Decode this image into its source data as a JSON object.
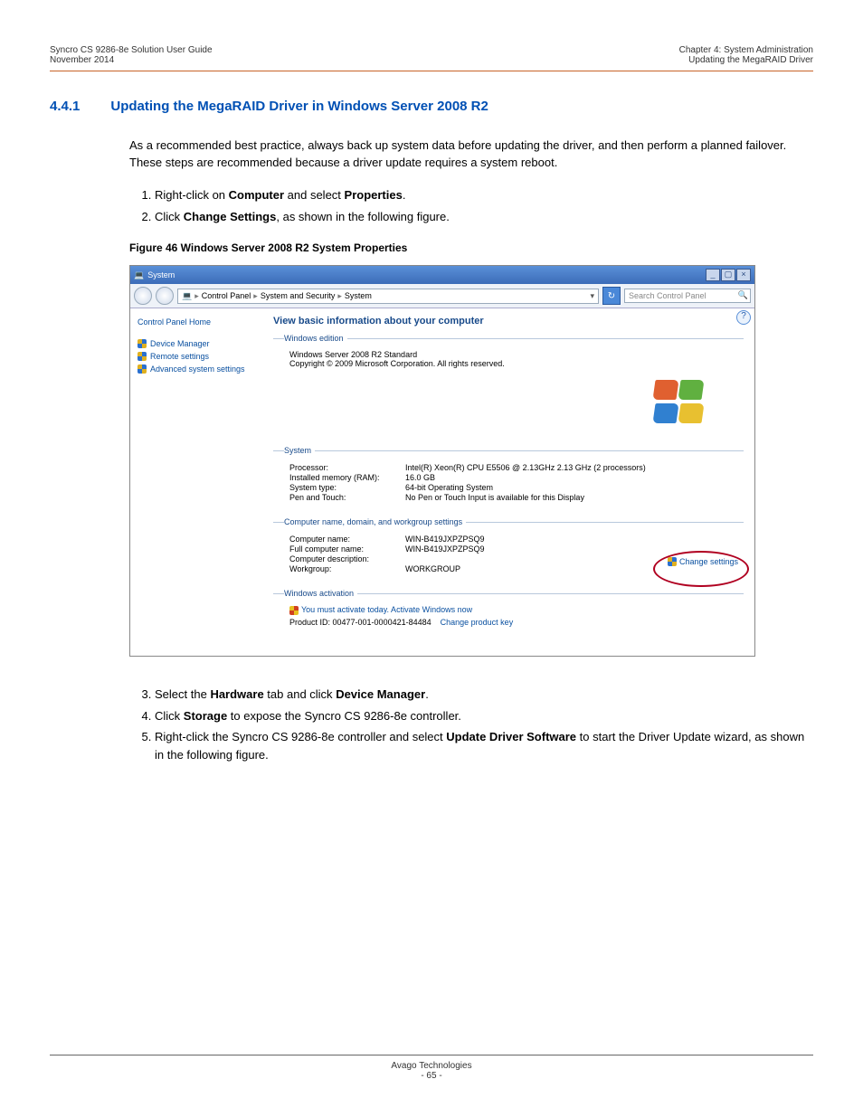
{
  "header": {
    "left1": "Syncro CS 9286-8e Solution User Guide",
    "left2": "November 2014",
    "right1": "Chapter 4: System Administration",
    "right2": "Updating the MegaRAID Driver"
  },
  "section": {
    "num": "4.4.1",
    "title": "Updating the MegaRAID Driver in Windows Server 2008 R2"
  },
  "intro": "As a recommended best practice, always back up system data before updating the driver, and then perform a planned failover. These steps are recommended because a driver update requires a system reboot.",
  "steps_a": {
    "s1_pre": "Right-click on ",
    "s1_b1": "Computer",
    "s1_mid": " and select ",
    "s1_b2": "Properties",
    "s1_end": ".",
    "s2_pre": "Click ",
    "s2_b": "Change Settings",
    "s2_end": ", as shown in the following figure."
  },
  "fig_cap": "Figure 46  Windows Server 2008 R2 System Properties",
  "win": {
    "title": "System",
    "crumbs": [
      "Control Panel",
      "System and Security",
      "System"
    ],
    "search_ph": "Search Control Panel",
    "sidebar": {
      "home": "Control Panel Home",
      "items": [
        "Device Manager",
        "Remote settings",
        "Advanced system settings"
      ]
    },
    "main_title": "View basic information about your computer",
    "edition_legend": "Windows edition",
    "edition_line1": "Windows Server 2008 R2 Standard",
    "edition_line2": "Copyright © 2009 Microsoft Corporation.  All rights reserved.",
    "system_legend": "System",
    "sys": {
      "proc_k": "Processor:",
      "proc_v": "Intel(R) Xeon(R) CPU       E5506  @ 2.13GHz   2.13 GHz  (2 processors)",
      "ram_k": "Installed memory (RAM):",
      "ram_v": "16.0 GB",
      "type_k": "System type:",
      "type_v": "64-bit Operating System",
      "pen_k": "Pen and Touch:",
      "pen_v": "No Pen or Touch Input is available for this Display"
    },
    "cnd_legend": "Computer name, domain, and workgroup settings",
    "cnd": {
      "cn_k": "Computer name:",
      "cn_v": "WIN-B419JXPZPSQ9",
      "fcn_k": "Full computer name:",
      "fcn_v": "WIN-B419JXPZPSQ9",
      "cd_k": "Computer description:",
      "cd_v": "",
      "wg_k": "Workgroup:",
      "wg_v": "WORKGROUP"
    },
    "change_settings": "Change settings",
    "act_legend": "Windows activation",
    "act_warn": "You must activate today.  Activate Windows now",
    "pid_label": "Product ID: 00477-001-0000421-84484",
    "change_key": "Change product key"
  },
  "steps_b": {
    "s3_pre": "Select the ",
    "s3_b1": "Hardware",
    "s3_mid": " tab and click ",
    "s3_b2": "Device Manager",
    "s3_end": ".",
    "s4_pre": "Click ",
    "s4_b": "Storage",
    "s4_end": " to expose the Syncro CS 9286-8e controller.",
    "s5_pre": "Right-click the Syncro CS 9286-8e controller and select ",
    "s5_b": "Update Driver Software",
    "s5_end": " to start the Driver Update wizard, as shown in the following figure."
  },
  "footer": {
    "company": "Avago Technologies",
    "page": "- 65 -"
  }
}
